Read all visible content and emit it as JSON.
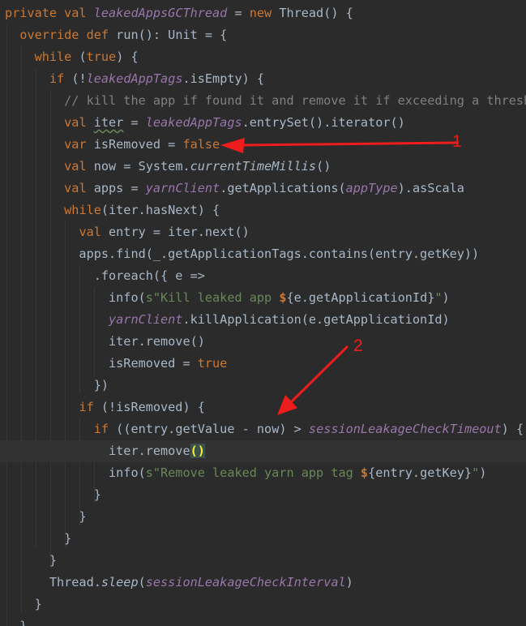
{
  "code": {
    "lines": [
      [
        [
          "kw",
          "private val "
        ],
        [
          "fld",
          "leakedAppsGCThread"
        ],
        [
          "t",
          " = "
        ],
        [
          "kw",
          "new "
        ],
        [
          "t",
          "Thread() {"
        ]
      ],
      [
        [
          "t",
          "  "
        ],
        [
          "kw",
          "override def "
        ],
        [
          "t",
          "run(): Unit = {"
        ]
      ],
      [
        [
          "t",
          "    "
        ],
        [
          "kw",
          "while "
        ],
        [
          "t",
          "("
        ],
        [
          "kw",
          "true"
        ],
        [
          "t",
          ") {"
        ]
      ],
      [
        [
          "t",
          "      "
        ],
        [
          "kw",
          "if "
        ],
        [
          "t",
          "(!"
        ],
        [
          "fld",
          "leakedAppTags"
        ],
        [
          "t",
          ".isEmpty) {"
        ]
      ],
      [
        [
          "t",
          "        "
        ],
        [
          "cmt",
          "// kill the app if found it and remove it if exceeding a threshold"
        ]
      ],
      [
        [
          "t",
          "        "
        ],
        [
          "kw",
          "val "
        ],
        [
          "ul",
          "iter"
        ],
        [
          "t",
          " = "
        ],
        [
          "fld",
          "leakedAppTags"
        ],
        [
          "t",
          ".entrySet().iterator()"
        ]
      ],
      [
        [
          "t",
          "        "
        ],
        [
          "kw",
          "var "
        ],
        [
          "t",
          "isRemoved = "
        ],
        [
          "kw",
          "false"
        ]
      ],
      [
        [
          "t",
          "        "
        ],
        [
          "kw",
          "val "
        ],
        [
          "t",
          "now = System."
        ],
        [
          "smth",
          "currentTimeMillis"
        ],
        [
          "t",
          "()"
        ]
      ],
      [
        [
          "t",
          "        "
        ],
        [
          "kw",
          "val "
        ],
        [
          "t",
          "apps = "
        ],
        [
          "fld",
          "yarnClient"
        ],
        [
          "t",
          ".getApplications("
        ],
        [
          "fld",
          "appType"
        ],
        [
          "t",
          ").asScala"
        ]
      ],
      [
        [
          "t",
          "        "
        ],
        [
          "kw",
          "while"
        ],
        [
          "t",
          "(iter.hasNext) {"
        ]
      ],
      [
        [
          "t",
          "          "
        ],
        [
          "kw",
          "val "
        ],
        [
          "t",
          "entry = iter.next()"
        ]
      ],
      [
        [
          "t",
          "          apps.find(_.getApplicationTags.contains(entry.getKey))"
        ]
      ],
      [
        [
          "t",
          "            .foreach({ e =>"
        ]
      ],
      [
        [
          "t",
          "              info("
        ],
        [
          "str",
          "s\"Kill leaked app "
        ],
        [
          "interp",
          "$"
        ],
        [
          "t",
          "{e.getApplicationId}"
        ],
        [
          "str",
          "\""
        ],
        [
          "t",
          ")"
        ]
      ],
      [
        [
          "t",
          "              "
        ],
        [
          "fld",
          "yarnClient"
        ],
        [
          "t",
          ".killApplication(e.getApplicationId)"
        ]
      ],
      [
        [
          "t",
          "              iter.remove()"
        ]
      ],
      [
        [
          "t",
          "              isRemoved = "
        ],
        [
          "kw",
          "true"
        ]
      ],
      [
        [
          "t",
          "            })"
        ]
      ],
      [
        [
          "t",
          "          "
        ],
        [
          "kw",
          "if "
        ],
        [
          "t",
          "(!isRemoved) {"
        ]
      ],
      [
        [
          "t",
          "            "
        ],
        [
          "kw",
          "if "
        ],
        [
          "t",
          "((entry.getValue - now) > "
        ],
        [
          "fld",
          "sessionLeakageCheckTimeout"
        ],
        [
          "t",
          ") {"
        ]
      ],
      [
        [
          "t",
          "              iter.remove"
        ],
        [
          "hl",
          "()"
        ]
      ],
      [
        [
          "t",
          "              info("
        ],
        [
          "str",
          "s\"Remove leaked yarn app tag "
        ],
        [
          "interp",
          "$"
        ],
        [
          "t",
          "{entry.getKey}"
        ],
        [
          "str",
          "\""
        ],
        [
          "t",
          ")"
        ]
      ],
      [
        [
          "t",
          "            }"
        ]
      ],
      [
        [
          "t",
          "          }"
        ]
      ],
      [
        [
          "t",
          "        }"
        ]
      ],
      [
        [
          "t",
          "      }"
        ]
      ],
      [
        [
          "t",
          "      Thread."
        ],
        [
          "smth",
          "sleep"
        ],
        [
          "t",
          "("
        ],
        [
          "fld",
          "sessionLeakageCheckInterval"
        ],
        [
          "t",
          ")"
        ]
      ],
      [
        [
          "t",
          "    }"
        ]
      ],
      [
        [
          "t",
          "  }"
        ]
      ]
    ],
    "current_line_index": 20
  },
  "annotations": {
    "labels": [
      "1",
      "2"
    ],
    "color": "#ee1c1c"
  },
  "theme": {
    "background": "#2b2b2b",
    "foreground": "#a9b7c6",
    "keyword": "#cc7832",
    "field": "#9876aa",
    "comment": "#808080",
    "string": "#6a8759",
    "current_line": "#323232",
    "brace_match": "#ffef28"
  }
}
